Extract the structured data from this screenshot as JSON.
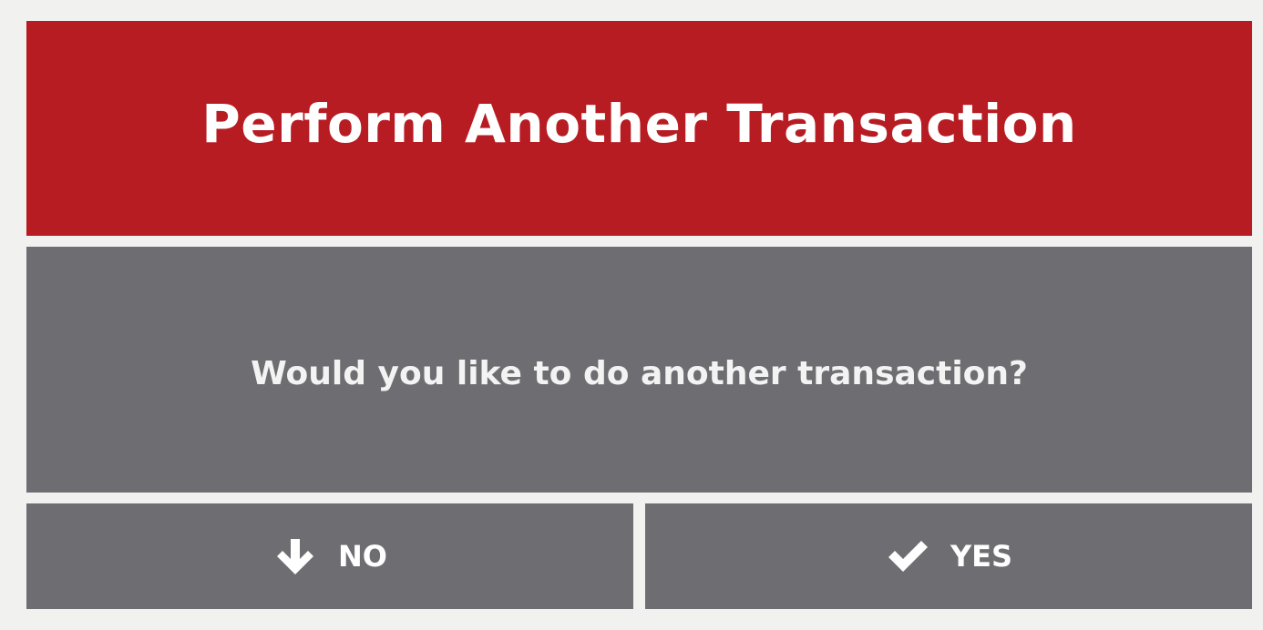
{
  "dialog": {
    "title": "Perform Another Transaction",
    "message": "Would you like to do another transaction?",
    "buttons": {
      "no": {
        "label": "NO",
        "icon": "arrow-down-icon"
      },
      "yes": {
        "label": "YES",
        "icon": "checkmark-icon"
      }
    }
  },
  "colors": {
    "header": "#b71c22",
    "panel": "#6e6e72",
    "background": "#f1f1f0",
    "text": "#ffffff"
  }
}
